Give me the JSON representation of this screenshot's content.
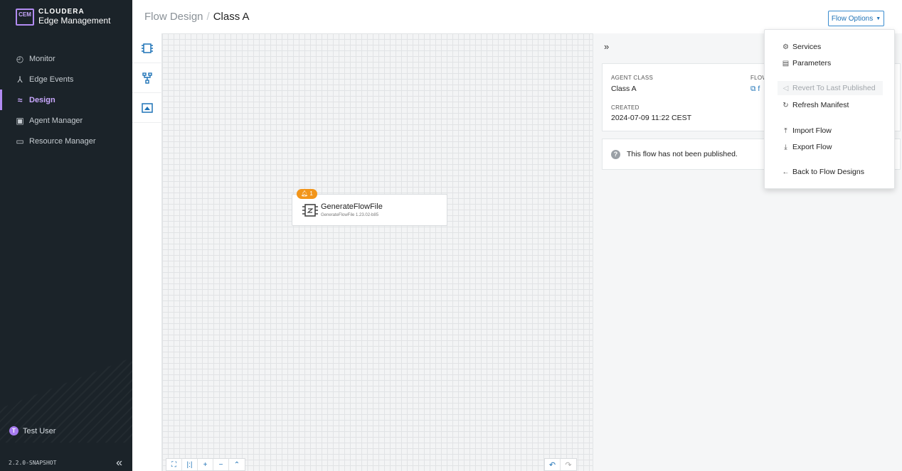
{
  "sidebar": {
    "logo_badge": "CEM",
    "logo_line1": "CLOUDERA",
    "logo_line2": "Edge Management",
    "nav": [
      {
        "label": "Monitor",
        "icon": "gauge-icon"
      },
      {
        "label": "Edge Events",
        "icon": "person-icon"
      },
      {
        "label": "Design",
        "icon": "design-icon",
        "active": true
      },
      {
        "label": "Agent Manager",
        "icon": "agent-icon"
      },
      {
        "label": "Resource Manager",
        "icon": "folder-icon"
      }
    ],
    "user_initial": "T",
    "user_name": "Test User",
    "version": "2.2.0-SNAPSHOT"
  },
  "header": {
    "breadcrumb_root": "Flow Design",
    "breadcrumb_sep": "/",
    "breadcrumb_current": "Class A",
    "flow_options_label": "Flow Options"
  },
  "canvas": {
    "processor": {
      "name": "GenerateFlowFile",
      "version": "GenerateFlowFile 1.23.02-b85",
      "badge_count": "1"
    }
  },
  "panel": {
    "agent_class_label": "AGENT CLASS",
    "agent_class_value": "Class A",
    "flow_label": "FLOW",
    "flow_value": "f",
    "created_label": "CREATED",
    "created_value": "2024-07-09 11:22 CEST",
    "notice": "This flow has not been published."
  },
  "dropdown": {
    "items": [
      {
        "label": "Services",
        "icon": "gear-icon"
      },
      {
        "label": "Parameters",
        "icon": "parameters-icon"
      },
      {
        "label": "Revert To Last Published",
        "icon": "revert-icon",
        "disabled": true
      },
      {
        "label": "Refresh Manifest",
        "icon": "refresh-icon"
      },
      {
        "label": "Import Flow",
        "icon": "upload-icon"
      },
      {
        "label": "Export Flow",
        "icon": "download-icon"
      },
      {
        "label": "Back to Flow Designs",
        "icon": "arrow-left-icon"
      }
    ]
  },
  "colors": {
    "sidebar_bg": "#1b2329",
    "accent_purple": "#b28bf2",
    "link_blue": "#1f73b7",
    "badge_orange": "#f2951a"
  }
}
